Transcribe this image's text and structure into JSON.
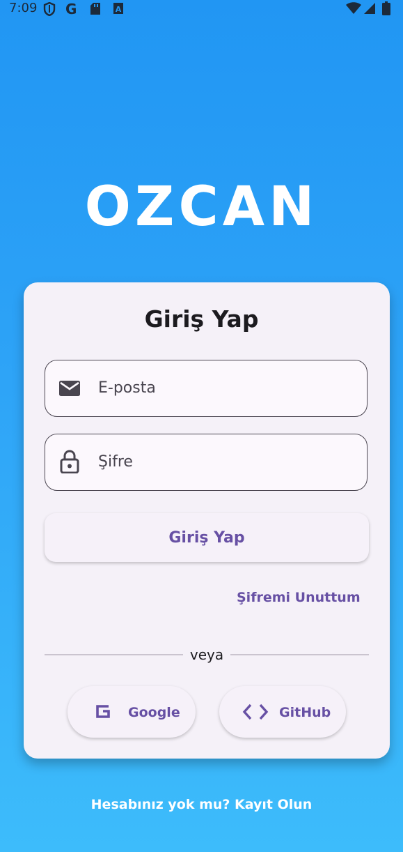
{
  "status_bar": {
    "time": "7:09",
    "left_icons": [
      "shield-icon",
      "google-g-icon",
      "sd-card-icon",
      "a-badge-icon"
    ],
    "right_icons": [
      "wifi-icon",
      "cellular-signal-icon",
      "battery-icon"
    ]
  },
  "app": {
    "brand": "OZCAN"
  },
  "login_card": {
    "title": "Giriş Yap",
    "email_placeholder": "E-posta",
    "password_placeholder": "Şifre",
    "login_button": "Giriş Yap",
    "forgot_password": "Şifremi Unuttum",
    "divider_text": "veya",
    "google_button": "Google",
    "github_button": "GitHub"
  },
  "footer": {
    "signup_text": "Hesabınız yok mu? Kayıt Olun"
  },
  "colors": {
    "background_top": "#2196F3",
    "background_bottom": "#3dbcfb",
    "card": "#f5f1f8",
    "accent": "#6750a4"
  }
}
